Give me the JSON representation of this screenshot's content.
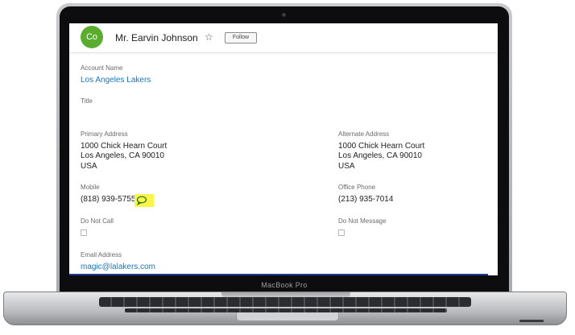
{
  "device": {
    "brand_label": "MacBook Pro"
  },
  "header": {
    "avatar_initials": "Co",
    "avatar_color": "#5aac2f",
    "contact_name": "Mr. Earvin Johnson",
    "star_icon": "star-outline-icon",
    "follow_label": "Follow"
  },
  "fields": {
    "account_name": {
      "label": "Account Name",
      "value": "Los Angeles Lakers"
    },
    "title": {
      "label": "Title",
      "value": ""
    },
    "primary_address": {
      "label": "Primary Address",
      "line1": "1000 Chick Hearn Court",
      "line2": "Los Angeles,  CA   90010",
      "line3": "USA"
    },
    "alternate_address": {
      "label": "Alternate Address",
      "line1": "1000 Chick Hearn Court",
      "line2": "Los Angeles,  CA   90010",
      "line3": "USA"
    },
    "mobile": {
      "label": "Mobile",
      "value": "(818) 939-5755",
      "icon": "chat-bubble-icon",
      "highlight": "#fbf64a"
    },
    "office_phone": {
      "label": "Office Phone",
      "value": "(213) 935-7014"
    },
    "do_not_call": {
      "label": "Do Not Call",
      "checked": false
    },
    "do_not_message": {
      "label": "Do Not Message",
      "checked": false
    },
    "email": {
      "label": "Email Address",
      "value": "magic@lalakers.com"
    }
  },
  "colors": {
    "link": "#1a75c2",
    "bottom_bar": "#1f3a8a"
  }
}
